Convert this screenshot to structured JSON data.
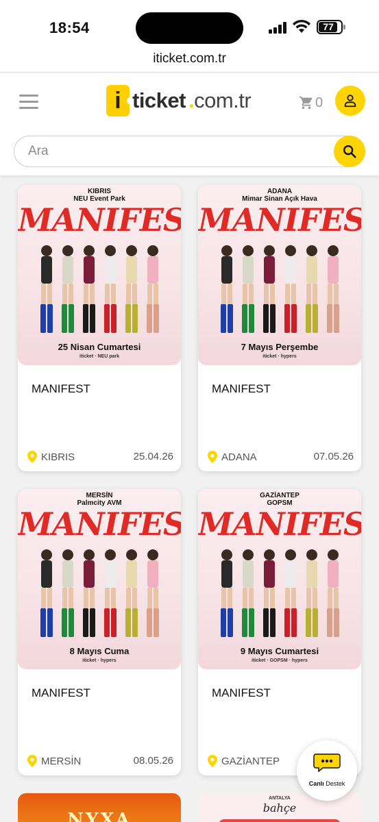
{
  "status_bar": {
    "time": "18:54",
    "battery": "77"
  },
  "browser": {
    "url": "iticket.com.tr"
  },
  "header": {
    "logo_icon_letter": "i",
    "logo_text": "ticket",
    "logo_dot": ".",
    "logo_tld": "com.tr",
    "cart_count": "0",
    "search_placeholder": "Ara",
    "brand_color": "#ffd400"
  },
  "events": [
    {
      "poster_city": "KIBRIS",
      "poster_venue": "NEU Event Park",
      "poster_title": "MANIFEST",
      "poster_date": "25 Nisan Cumartesi",
      "poster_sponsors": "iticket  ·  NEU park",
      "name": "MANIFEST",
      "location": "KIBRIS",
      "date": "25.04.26"
    },
    {
      "poster_city": "ADANA",
      "poster_venue": "Mimar Sinan Açık Hava",
      "poster_title": "MANIFEST",
      "poster_date": "7 Mayıs Perşembe",
      "poster_sponsors": "iticket  ·  hypers",
      "name": "MANIFEST",
      "location": "ADANA",
      "date": "07.05.26"
    },
    {
      "poster_city": "MERSİN",
      "poster_venue": "Palmcity AVM",
      "poster_title": "MANIFEST",
      "poster_date": "8 Mayıs Cuma",
      "poster_sponsors": "iticket  ·  hypers",
      "name": "MANIFEST",
      "location": "MERSİN",
      "date": "08.05.26"
    },
    {
      "poster_city": "GAZİANTEP",
      "poster_venue": "GOPSM",
      "poster_title": "MANIFEST",
      "poster_date": "9 Mayıs Cumartesi",
      "poster_sponsors": "iticket  ·  GOPSM  ·  hypers",
      "name": "MANIFEST",
      "location": "GAZİANTEP",
      "date": ""
    }
  ],
  "partial_cards": [
    {
      "label": "NYXA"
    },
    {
      "label_top": "ANTALYA",
      "label": "bahçe"
    }
  ],
  "live_support": {
    "label_bold": "Canlı",
    "label": " Destek"
  }
}
